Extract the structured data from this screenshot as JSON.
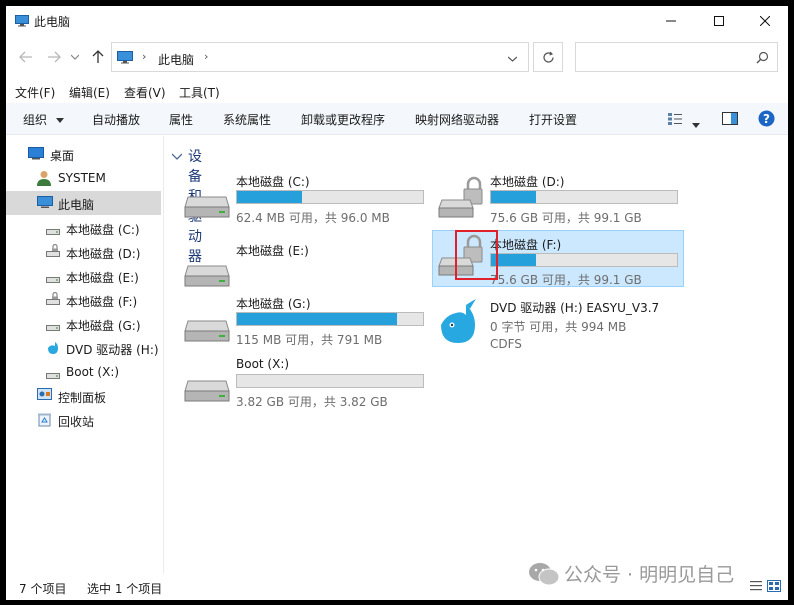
{
  "window": {
    "title": "此电脑"
  },
  "address": {
    "crumb": "此电脑",
    "search_placeholder": ""
  },
  "menu": [
    "文件(F)",
    "编辑(E)",
    "查看(V)",
    "工具(T)"
  ],
  "toolbar": {
    "organize": "组织",
    "autoplay": "自动播放",
    "properties": "属性",
    "system_properties": "系统属性",
    "uninstall": "卸载或更改程序",
    "map_drive": "映射网络驱动器",
    "open_settings": "打开设置"
  },
  "nav": {
    "desktop": "桌面",
    "system": "SYSTEM",
    "this_pc": "此电脑",
    "c": "本地磁盘 (C:)",
    "d": "本地磁盘 (D:)",
    "e": "本地磁盘 (E:)",
    "f": "本地磁盘 (F:)",
    "g": "本地磁盘 (G:)",
    "h": "DVD 驱动器 (H:)",
    "x": "Boot (X:)",
    "control_panel": "控制面板",
    "recycle_bin": "回收站"
  },
  "group": {
    "title": "设备和驱动器 (7)"
  },
  "drives": {
    "c": {
      "name": "本地磁盘 (C:)",
      "info": "62.4 MB 可用，共 96.0 MB",
      "used_fraction": 0.35
    },
    "d": {
      "name": "本地磁盘 (D:)",
      "info": "75.6 GB 可用，共 99.1 GB",
      "used_fraction": 0.24
    },
    "e": {
      "name": "本地磁盘 (E:)"
    },
    "f": {
      "name": "本地磁盘 (F:)",
      "info": "75.6 GB 可用，共 99.1 GB",
      "used_fraction": 0.24
    },
    "g": {
      "name": "本地磁盘 (G:)",
      "info": "115 MB 可用，共 791 MB",
      "used_fraction": 0.86
    },
    "h": {
      "name": "DVD 驱动器 (H:) EASYU_V3.7",
      "info": "0 字节 可用，共 994 MB",
      "fs": "CDFS"
    },
    "x": {
      "name": "Boot (X:)",
      "info": "3.82 GB 可用，共 3.82 GB",
      "used_fraction": 0.0
    }
  },
  "status": {
    "count": "7 个项目",
    "selected": "选中 1 个项目"
  },
  "watermark": "公众号 · 明明见自己",
  "colors": {
    "accent": "#26a0da",
    "selection": "#cce8ff",
    "highlight_box": "#e0202a"
  }
}
